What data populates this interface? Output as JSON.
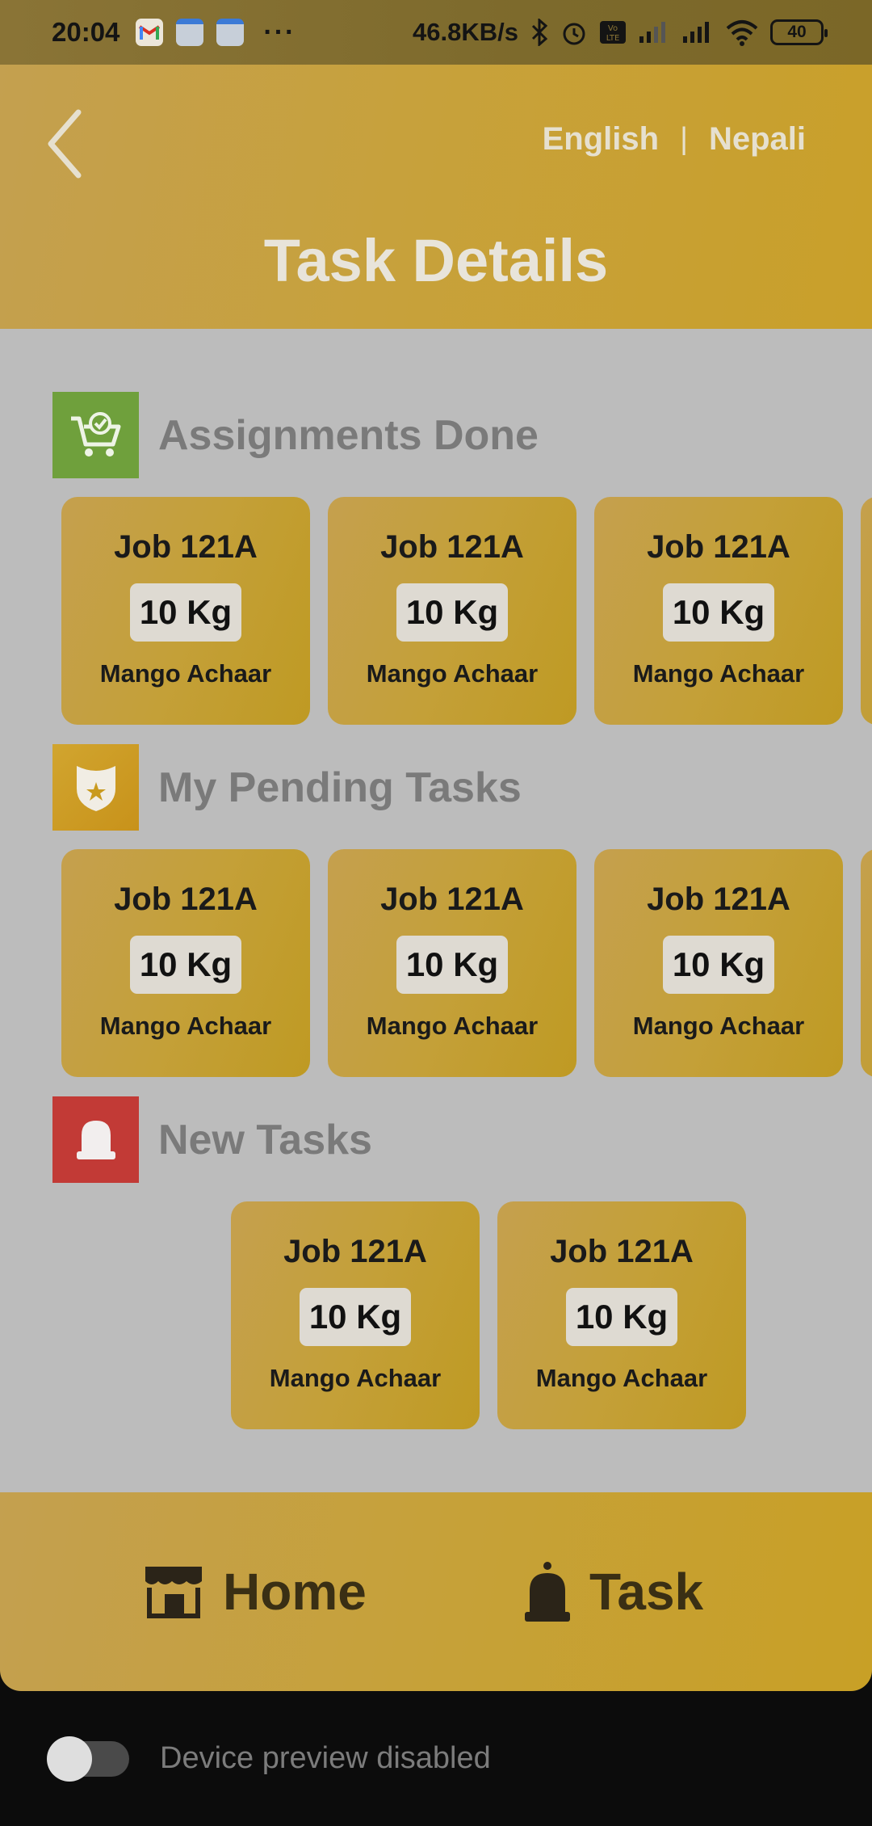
{
  "status_bar": {
    "time": "20:04",
    "net_speed": "46.8KB/s",
    "battery": "40"
  },
  "header": {
    "lang_english": "English",
    "lang_separator": "|",
    "lang_nepali": "Nepali",
    "title": "Task Details"
  },
  "sections": {
    "done": {
      "title": "Assignments Done",
      "icon": "cart-check-icon",
      "icon_bg": "#6fa03c",
      "cards": [
        {
          "job": "Job 121A",
          "qty": "10 Kg",
          "item": "Mango Achaar"
        },
        {
          "job": "Job 121A",
          "qty": "10 Kg",
          "item": "Mango Achaar"
        },
        {
          "job": "Job 121A",
          "qty": "10 Kg",
          "item": "Mango Achaar"
        }
      ]
    },
    "pending": {
      "title": "My Pending Tasks",
      "icon": "star-shield-icon",
      "icon_bg": "#c99a1e",
      "cards": [
        {
          "job": "Job 121A",
          "qty": "10 Kg",
          "item": "Mango Achaar"
        },
        {
          "job": "Job 121A",
          "qty": "10 Kg",
          "item": "Mango Achaar"
        },
        {
          "job": "Job 121A",
          "qty": "10 Kg",
          "item": "Mango Achaar"
        }
      ]
    },
    "new": {
      "title": "New Tasks",
      "icon": "bell-icon",
      "icon_bg": "#c23a36",
      "cards": [
        {
          "job": "Job 121A",
          "qty": "10 Kg",
          "item": "Mango Achaar"
        },
        {
          "job": "Job 121A",
          "qty": "10 Kg",
          "item": "Mango Achaar"
        }
      ]
    }
  },
  "bottom_nav": {
    "home_label": "Home",
    "task_label": "Task"
  },
  "device_preview": {
    "label": "Device preview disabled"
  },
  "colors": {
    "header_accent": "#c7a13c",
    "content_bg": "#bcbcbc",
    "card_bg": "#c4a039"
  }
}
